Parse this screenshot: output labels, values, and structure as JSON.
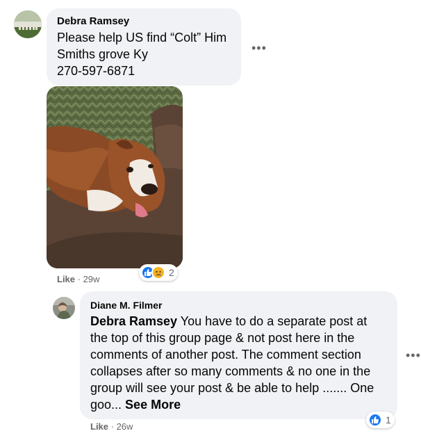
{
  "comment1": {
    "author": "Debra Ramsey",
    "lines": [
      "Please help US find “Colt” Him",
      "Smiths grove Ky",
      "270-597-6871"
    ],
    "like_label": "Like",
    "time": "29w",
    "reaction_count": "2",
    "reactions": [
      "like-icon",
      "sad-icon"
    ]
  },
  "comment2": {
    "author": "Diane M. Filmer",
    "mention": "Debra Ramsey",
    "lines": [
      " You have to do a separate post at",
      "the top of this group page & not post here in the",
      "comments of another post. The comment section",
      "collapses after so many comments & no one in the",
      "group will see your post & be able to help ....... One",
      "goo... "
    ],
    "see_more": "See More",
    "like_label": "Like",
    "time": "26w",
    "reaction_count": "1",
    "reactions": [
      "like-icon"
    ]
  },
  "separator": " · ",
  "colors": {
    "like_blue": "#1877f2",
    "bubble_bg": "#f0f2f5",
    "meta_gray": "#65676b"
  }
}
